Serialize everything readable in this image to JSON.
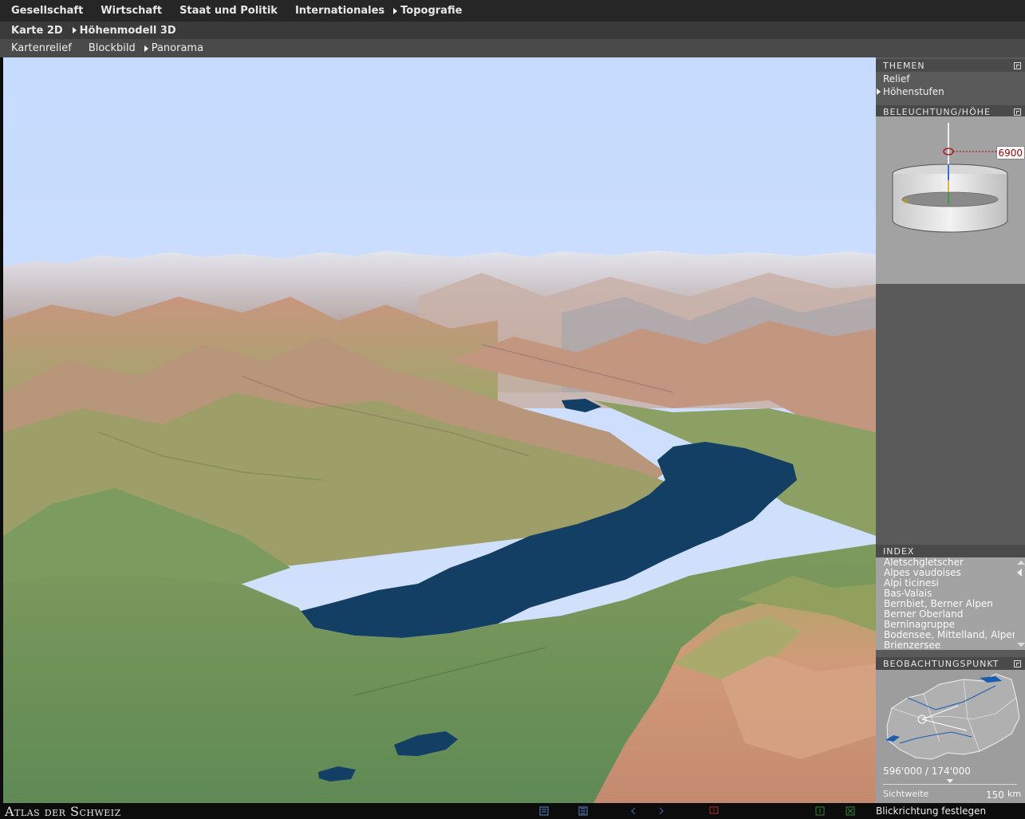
{
  "nav": {
    "level1": [
      {
        "label": "Gesellschaft",
        "active": false
      },
      {
        "label": "Wirtschaft",
        "active": false
      },
      {
        "label": "Staat und Politik",
        "active": false
      },
      {
        "label": "Internationales",
        "active": false
      },
      {
        "label": "Topografie",
        "active": true
      }
    ],
    "level2": [
      {
        "label": "Karte 2D",
        "active": false
      },
      {
        "label": "Höhenmodell 3D",
        "active": true
      }
    ],
    "level3": [
      {
        "label": "Kartenrelief",
        "active": false
      },
      {
        "label": "Blockbild",
        "active": false
      },
      {
        "label": "Panorama",
        "active": true
      }
    ]
  },
  "themes": {
    "title": "THEMEN",
    "items": [
      {
        "label": "Relief",
        "active": false
      },
      {
        "label": "Höhenstufen",
        "active": true
      }
    ]
  },
  "lighting": {
    "title": "BELEUCHTUNG/HÖHE",
    "height_value": "6900"
  },
  "index": {
    "title": "INDEX",
    "items": [
      "Aletschgletscher",
      "Alpes vaudoises",
      "Alpi ticinesi",
      "Bas-Valais",
      "Bernbiet, Berner Alpen",
      "Berner Oberland",
      "Berninagruppe",
      "Bodensee, Mittelland, Alpen",
      "Brienzersee"
    ]
  },
  "observation": {
    "title": "BEOBACHTUNGSPUNKT",
    "coords": "596'000 / 174'000",
    "sichtweite_label": "Sichtweite",
    "sichtweite_value": "150",
    "sichtweite_unit": "km",
    "sichtweite_level": 0.5
  },
  "footer": {
    "brand": "Atlas der Schweiz",
    "status": "Blickrichtung festlegen"
  },
  "colors": {
    "sky": "#c9dcff",
    "lake": "#123f63",
    "terrain_low": "#6f9a5c",
    "terrain_mid": "#c99a7f",
    "terrain_high": "#d8d8dc",
    "accent_red": "#b00000"
  }
}
